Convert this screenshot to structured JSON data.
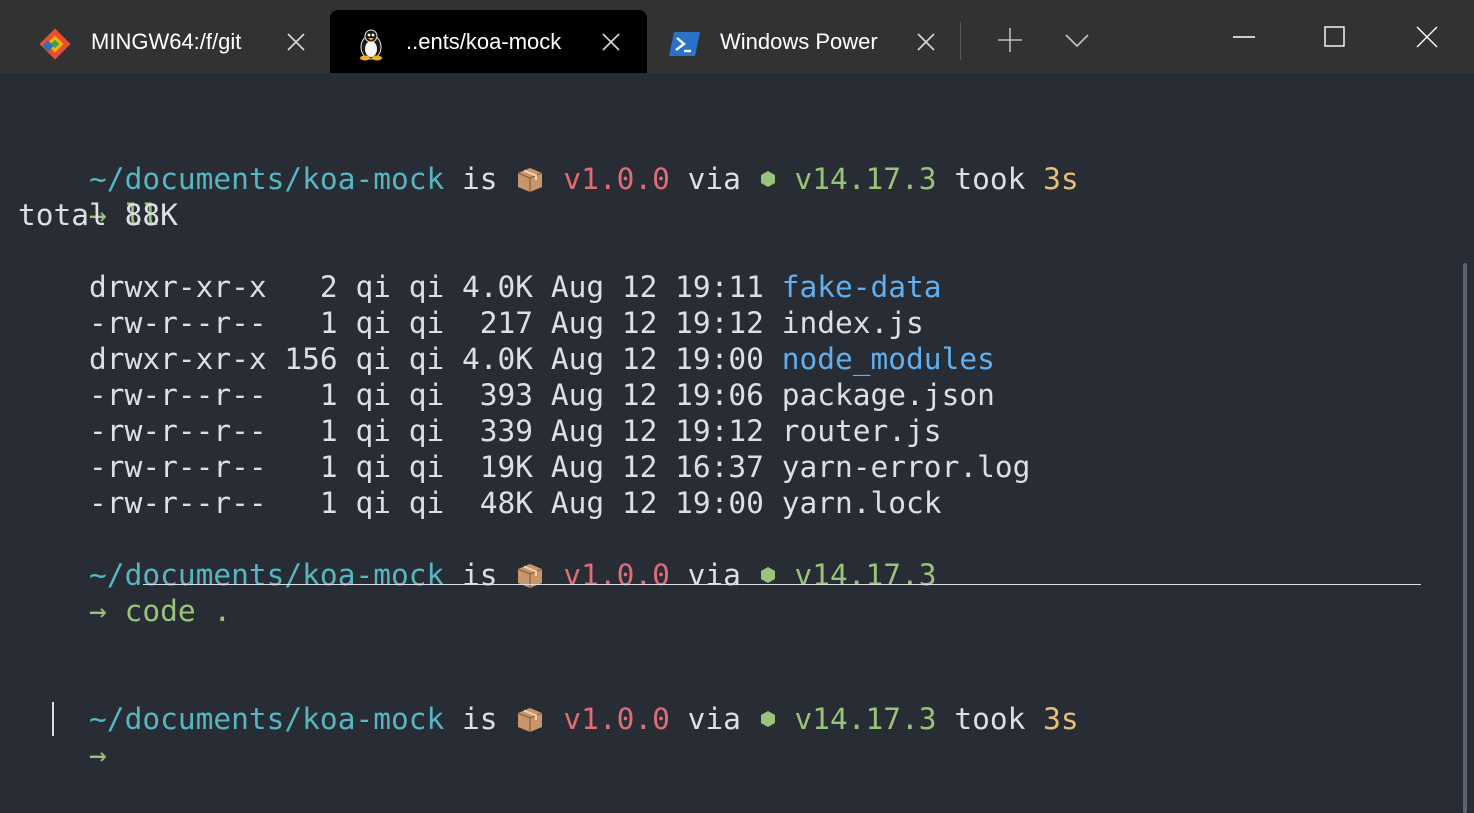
{
  "tabs": [
    {
      "title": "MINGW64:/f/git",
      "icon": "git-bash-icon",
      "active": false
    },
    {
      "title": "..ents/koa-mock",
      "icon": "linux-penguin-icon",
      "active": true
    },
    {
      "title": "Windows Power",
      "icon": "powershell-icon",
      "active": false
    }
  ],
  "prompt": {
    "path": "~/documents/koa-mock",
    "is": " is ",
    "version": "v1.0.0",
    "via": " via ",
    "node_version": "v14.17.3",
    "took": " took ",
    "duration": "3s",
    "arrow": "→"
  },
  "commands": [
    "ll",
    "code ."
  ],
  "listing": {
    "total": "total 88K",
    "rows": [
      {
        "meta": "drwxr-xr-x   2 qi qi 4.0K Aug 12 19:11 ",
        "name": "fake-data",
        "is_dir": true
      },
      {
        "meta": "-rw-r--r--   1 qi qi  217 Aug 12 19:12 ",
        "name": "index.js",
        "is_dir": false
      },
      {
        "meta": "drwxr-xr-x 156 qi qi 4.0K Aug 12 19:00 ",
        "name": "node_modules",
        "is_dir": true
      },
      {
        "meta": "-rw-r--r--   1 qi qi  393 Aug 12 19:06 ",
        "name": "package.json",
        "is_dir": false
      },
      {
        "meta": "-rw-r--r--   1 qi qi  339 Aug 12 19:12 ",
        "name": "router.js",
        "is_dir": false
      },
      {
        "meta": "-rw-r--r--   1 qi qi  19K Aug 12 16:37 ",
        "name": "yarn-error.log",
        "is_dir": false
      },
      {
        "meta": "-rw-r--r--   1 qi qi  48K Aug 12 19:00 ",
        "name": "yarn.lock",
        "is_dir": false
      }
    ]
  },
  "colors": {
    "background": "#282c34",
    "titlebar": "#323232",
    "active_tab": "#000000",
    "path": "#56b6c2",
    "version": "#e06c75",
    "node": "#98c379",
    "duration": "#e5c07b",
    "directory": "#61afef",
    "text": "#dcdfe4"
  },
  "icons": {
    "package": "package-box-icon",
    "node": "node-hexagon-icon",
    "new_tab": "plus-icon",
    "dropdown": "chevron-down-icon",
    "minimize": "minimize-icon",
    "maximize": "maximize-icon",
    "close": "close-icon"
  }
}
